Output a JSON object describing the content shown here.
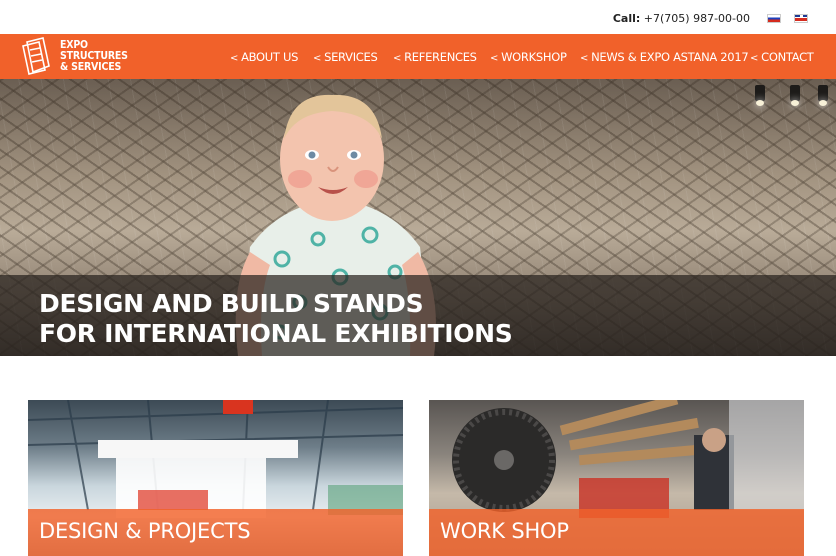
{
  "header": {
    "call_label": "Call:",
    "phone": "+7(705) 987-00-00",
    "languages": [
      {
        "code": "ru",
        "icon": "flag-russia-icon"
      },
      {
        "code": "en",
        "icon": "flag-uk-icon"
      }
    ]
  },
  "brand": {
    "lines": [
      "EXPO",
      "STRUCTURES",
      "& SERVICES"
    ],
    "color": "#f1612a"
  },
  "nav": {
    "items": [
      {
        "label": "ABOUT US"
      },
      {
        "label": "SERVICES"
      },
      {
        "label": "REFERENCES"
      },
      {
        "label": "WORKSHOP"
      },
      {
        "label": "NEWS & EXPO ASTANA 2017"
      },
      {
        "label": "CONTACT"
      }
    ]
  },
  "hero": {
    "title_lines": [
      "DESIGN AND BUILD STANDS",
      "FOR INTERNATIONAL EXHIBITIONS"
    ]
  },
  "cards": [
    {
      "title": "DESIGN & PROJECTS"
    },
    {
      "title": "WORK SHOP"
    }
  ]
}
